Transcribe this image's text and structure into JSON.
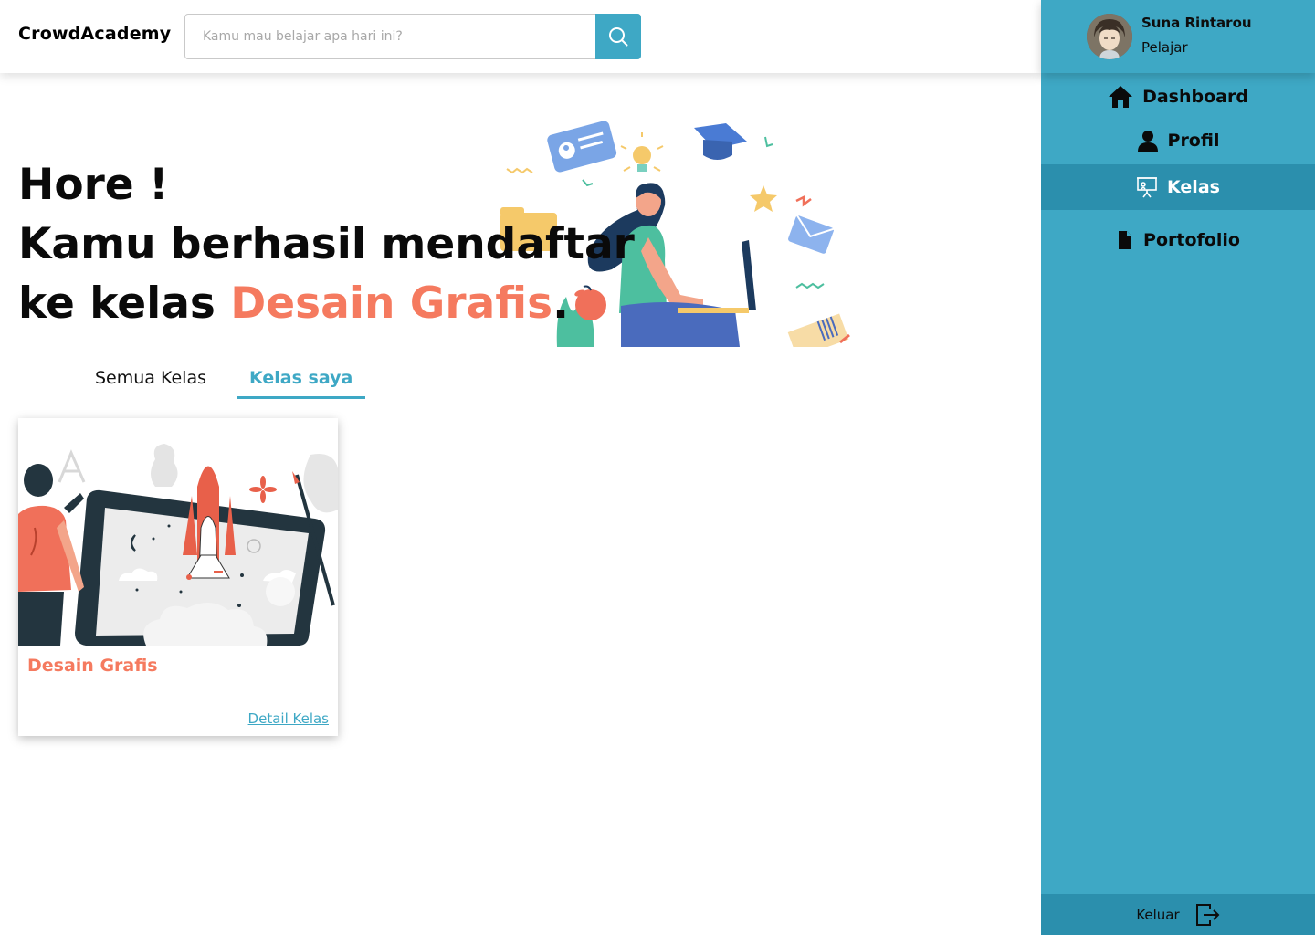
{
  "brand": {
    "name": "CrowdAcademy"
  },
  "search": {
    "placeholder": "Kamu mau belajar apa hari ini?",
    "icon": "search-icon"
  },
  "user": {
    "name": "Suna Rintarou",
    "role": "Pelajar"
  },
  "nav": {
    "items": [
      {
        "label": "Dashboard",
        "icon": "home-icon",
        "active": false
      },
      {
        "label": "Profil",
        "icon": "user-icon",
        "active": false
      },
      {
        "label": "Kelas",
        "icon": "presentation-board-icon",
        "active": true
      },
      {
        "label": "Portofolio",
        "icon": "document-icon",
        "active": false
      }
    ],
    "logout": {
      "label": "Keluar",
      "icon": "logout-icon"
    }
  },
  "hero": {
    "line1": "Hore !",
    "line2": "Kamu berhasil mendaftar",
    "line3_prefix": "ke kelas ",
    "line3_course": "Desain Grafis",
    "line3_suffix": "."
  },
  "tabs": [
    {
      "label": "Semua Kelas",
      "active": false
    },
    {
      "label": "Kelas saya",
      "active": true
    }
  ],
  "courses": [
    {
      "title": "Desain Grafis",
      "link_label": "Detail Kelas"
    }
  ],
  "colors": {
    "primary": "#3ea8c5",
    "primary_dark": "#2b8fad",
    "accent": "#f57a5f"
  }
}
